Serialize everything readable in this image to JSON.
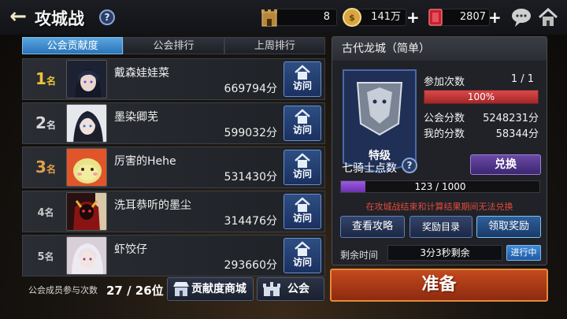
{
  "header": {
    "title": "攻城战",
    "help_label": "?",
    "castle_count": "8",
    "gold": "141万",
    "gems": "2807",
    "plus": "+"
  },
  "tabs": [
    {
      "label": "公会贡献度",
      "active": true
    },
    {
      "label": "公会排行",
      "active": false
    },
    {
      "label": "上周排行",
      "active": false
    }
  ],
  "ranking": {
    "rank_suffix": "名",
    "visit_label": "访问",
    "rows": [
      {
        "rank": "1",
        "name": "戴森娃娃菜",
        "score": "669794分"
      },
      {
        "rank": "2",
        "name": "墨染卿芜",
        "score": "599032分"
      },
      {
        "rank": "3",
        "name": "厉害的Hehe",
        "score": "531430分"
      },
      {
        "rank": "4",
        "name": "洗耳恭听的墨尘",
        "score": "314476分"
      },
      {
        "rank": "5",
        "name": "虾饺仔",
        "score": "293660分"
      }
    ]
  },
  "footer": {
    "participation_label": "公会成员参与次数",
    "participation_value": "27 / 26位",
    "shop_button": "贡献度商城",
    "guild_button": "公会"
  },
  "panel": {
    "title": "古代龙城（简单）",
    "grade": "特级",
    "attempts_label": "参加次数",
    "attempts_value": "1 / 1",
    "attempts_percent_text": "100%",
    "attempts_fraction": 1.0,
    "guild_score_label": "公会分数",
    "guild_score_value": "5248231分",
    "my_score_label": "我的分数",
    "my_score_value": "58344分",
    "knights_label": "七骑士点数",
    "exchange_button": "兑换",
    "knights_progress_text": "123 / 1000",
    "knights_fraction": 0.123,
    "warning": "在攻城战结束和计算结果期间无法兑换",
    "strategy_button": "查看攻略",
    "rewards_list_button": "奖励目录",
    "claim_button": "领取奖励",
    "time_label": "剩余时间",
    "time_value": "3分3秒剩余",
    "status_tag": "进行中"
  },
  "ready_button": "准备"
}
